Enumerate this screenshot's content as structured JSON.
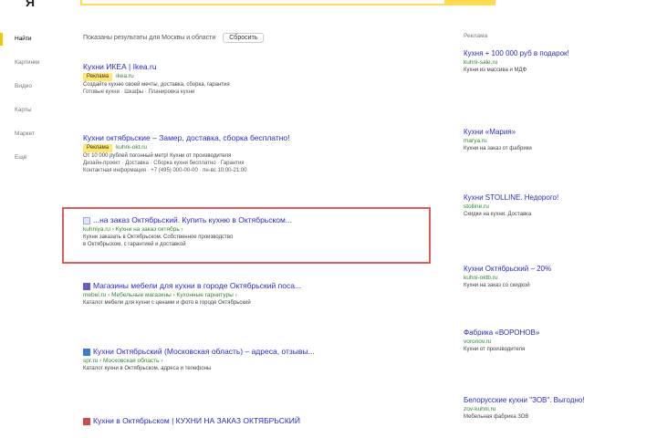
{
  "header": {
    "logo": "Я"
  },
  "leftnav": {
    "items": [
      {
        "label": "Найти",
        "active": true
      },
      {
        "label": "Картинки",
        "active": false
      },
      {
        "label": "Видео",
        "active": false
      },
      {
        "label": "Карты",
        "active": false
      },
      {
        "label": "Маркет",
        "active": false
      },
      {
        "label": "Ещё",
        "active": false
      }
    ]
  },
  "region": {
    "text": "Показаны результаты для Москвы и области",
    "reset_label": "Сбросить"
  },
  "results": [
    {
      "title": "Кухни ИКЕА | Ikea.ru",
      "badge": "Реклама",
      "url": "ikea.ru",
      "desc": "Создайте кухню своей мечты, доставка, сборка, гарантия",
      "links": "Готовые кухни · Шкафы · Планировка кухни"
    },
    {
      "title": "Кухни октябрьские – Замер, доставка, сборка бесплатно!",
      "badge": "Реклама",
      "url": "kuhni-okt.ru",
      "desc": "От 10 000 рублей погонный метр! Кухни от производителя",
      "links": "Дизайн-проект · Доставка · Сборка кухни бесплатно · Гарантия",
      "links2": "Контактная информация · +7 (495) 000-00-00 · пн-вс 10:00-21:00"
    },
    {
      "title": "...на заказ Октябрьский. Купить кухню в Октябрьском...",
      "url": "kuhniya.ru › Кухни на заказ октябрь ›",
      "desc": "Кухни заказать в Октябрьском. Собственное производство",
      "desc2": "в Октябрьском, с гарантией и доставкой"
    },
    {
      "title": "Магазины мебели для кухни в городе Октябрьский поса...",
      "url": "mebel.ru › Мебельные магазины › Кухонные гарнитуры ›",
      "desc": "Каталог мебели для кухни с ценами и фото в городе Октябрьский"
    },
    {
      "title": "Кухни Октябрьский (Московская область) – адреса, отзывы...",
      "url": "spr.ru › Московская область ›",
      "desc": "Каталог кухни в Октябрьском, адреса и телефоны"
    },
    {
      "title": "Кухни в Октябрьском | КУХНИ НА ЗАКАЗ ОКТЯБРЬСКИЙ"
    }
  ],
  "ads": {
    "header": "Реклама",
    "items": [
      {
        "title": "Кухня + 100 000 руб в подарок!",
        "url": "kuhni-sale.ru",
        "desc": "Кухни из массива и МДФ"
      },
      {
        "title": "Кухни «Мария»",
        "url": "marya.ru",
        "desc": "Кухни на заказ от фабрики"
      },
      {
        "title": "Кухни STOLLINE. Недорого!",
        "url": "stolline.ru",
        "desc": "Скидки на кухни. Доставка"
      },
      {
        "title": "Кухни Октябрьский – 20%",
        "url": "kuhni-oktb.ru",
        "desc": "Кухни на заказ со скидкой"
      },
      {
        "title": "Фабрика «ВОРОНОВ»",
        "url": "voronov.ru",
        "desc": "Кухни от производителя"
      },
      {
        "title": "Белорусские кухни \"ЗОВ\". Выгодно!",
        "url": "zov-kuhni.ru",
        "desc": "Мебельная фабрика ЗОВ"
      }
    ]
  },
  "colors": {
    "accent": "#ffdb4d",
    "link": "#2a2ac8",
    "url": "#2c8a2c",
    "highlight_border": "#e35a5a"
  }
}
